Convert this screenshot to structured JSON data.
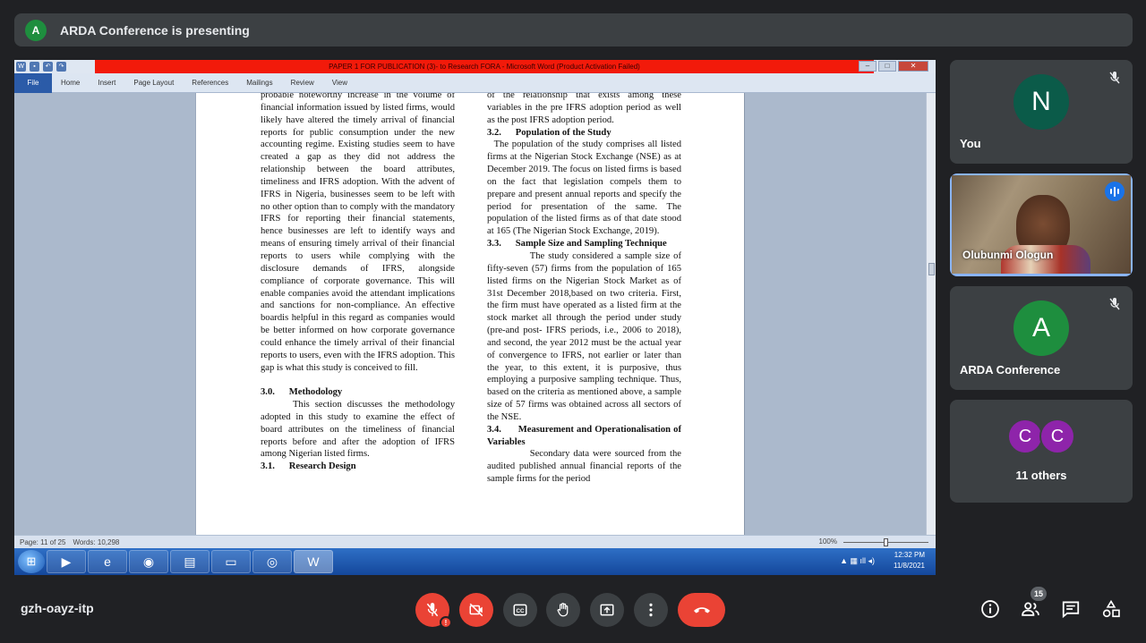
{
  "presenting_bar": {
    "avatar_letter": "A",
    "text": "ARDA Conference is presenting"
  },
  "word_window": {
    "title": "PAPER 1 FOR PUBLICATION (3)- to Research FORA - Microsoft Word (Product Activation Failed)",
    "ribbon_tabs": [
      "File",
      "Home",
      "Insert",
      "Page Layout",
      "References",
      "Mailings",
      "Review",
      "View"
    ],
    "status_page": "Page: 11 of 25",
    "status_words": "Words: 10,298",
    "zoom": "100%",
    "clock_time": "12:32 PM",
    "clock_date": "11/8/2021",
    "left_column": [
      {
        "style": "p",
        "text": "probable noteworthy increase in the volume of financial information issued by listed firms, would likely have altered the timely arrival of financial reports for public consumption under the new accounting regime. Existing studies seem to have created a gap as they did not address the relationship between the board attributes, timeliness and IFRS adoption. With the advent of IFRS in Nigeria, businesses seem to be left with no other option than to comply with the mandatory IFRS for reporting their financial statements, hence businesses are left to identify ways and means of ensuring timely arrival of their financial reports to users while complying with the disclosure demands of IFRS, alongside compliance of corporate governance. This will enable companies avoid the attendant implications and sanctions for non-compliance. An effective boardis helpful in this regard as companies would be better informed on how corporate governance could enhance the timely arrival of their financial reports to users, even with the IFRS adoption. This gap is what this study is conceived to fill."
      },
      {
        "style": "gap",
        "text": ""
      },
      {
        "style": "h",
        "text": "3.0.      Methodology"
      },
      {
        "style": "p",
        "text": "      This section discusses the methodology adopted in this study to examine the effect of board attributes on the timeliness of financial reports before and after the adoption of IFRS among Nigerian listed firms."
      },
      {
        "style": "h",
        "text": "3.1.      Research Design"
      }
    ],
    "right_column": [
      {
        "style": "p",
        "text": "of the relationship that exists among these variables in the pre IFRS adoption period as well as the post IFRS adoption period."
      },
      {
        "style": "h",
        "text": "3.2.      Population of the Study"
      },
      {
        "style": "p",
        "text": "  The population of the study comprises all listed firms at the Nigerian Stock Exchange (NSE) as at December 2019. The focus on listed firms is based on the fact that legislation compels them to prepare and present annual reports and specify the period for presentation of the same. The population of the listed firms as of that date stood at 165 (The Nigerian Stock Exchange, 2019)."
      },
      {
        "style": "h",
        "text": "3.3.      Sample Size and Sampling Technique"
      },
      {
        "style": "p",
        "text": "            The study considered a sample size of fifty-seven (57) firms from the population of 165 listed firms on the Nigerian Stock Market as of 31st December 2018,based on two criteria. First, the firm must have operated as a listed firm at the stock market all through the period under study (pre-and post- IFRS periods, i.e., 2006 to 2018), and second, the year 2012 must be the actual year of convergence to IFRS, not earlier or later than the year, to this extent, it is purposive, thus employing a purposive sampling technique. Thus, based on the criteria as mentioned above, a sample size of 57 firms was obtained across all sectors of the NSE."
      },
      {
        "style": "h",
        "text": "3.4.      Measurement and Operationalisation of Variables"
      },
      {
        "style": "p",
        "text": "            Secondary data were sourced from the audited published annual financial reports of the sample firms for the period"
      }
    ]
  },
  "participants": [
    {
      "letter": "N",
      "name": "You",
      "color": "#0b5b49"
    },
    {
      "name": "Olubunmi Ologun"
    },
    {
      "letter": "A",
      "name": "ARDA Conference",
      "color": "#1e8e3e"
    },
    {
      "letters": [
        "C",
        "C"
      ],
      "name": "11 others",
      "color": "#8e24aa"
    }
  ],
  "bottom_bar": {
    "meeting_code": "gzh-oayz-itp",
    "warning_mark": "!",
    "participant_count": "15",
    "icons": [
      "mic-off-icon",
      "camera-off-icon",
      "captions-icon",
      "raise-hand-icon",
      "present-icon",
      "more-options-icon",
      "end-call-icon",
      "info-icon",
      "people-icon",
      "chat-icon",
      "activities-icon"
    ]
  }
}
